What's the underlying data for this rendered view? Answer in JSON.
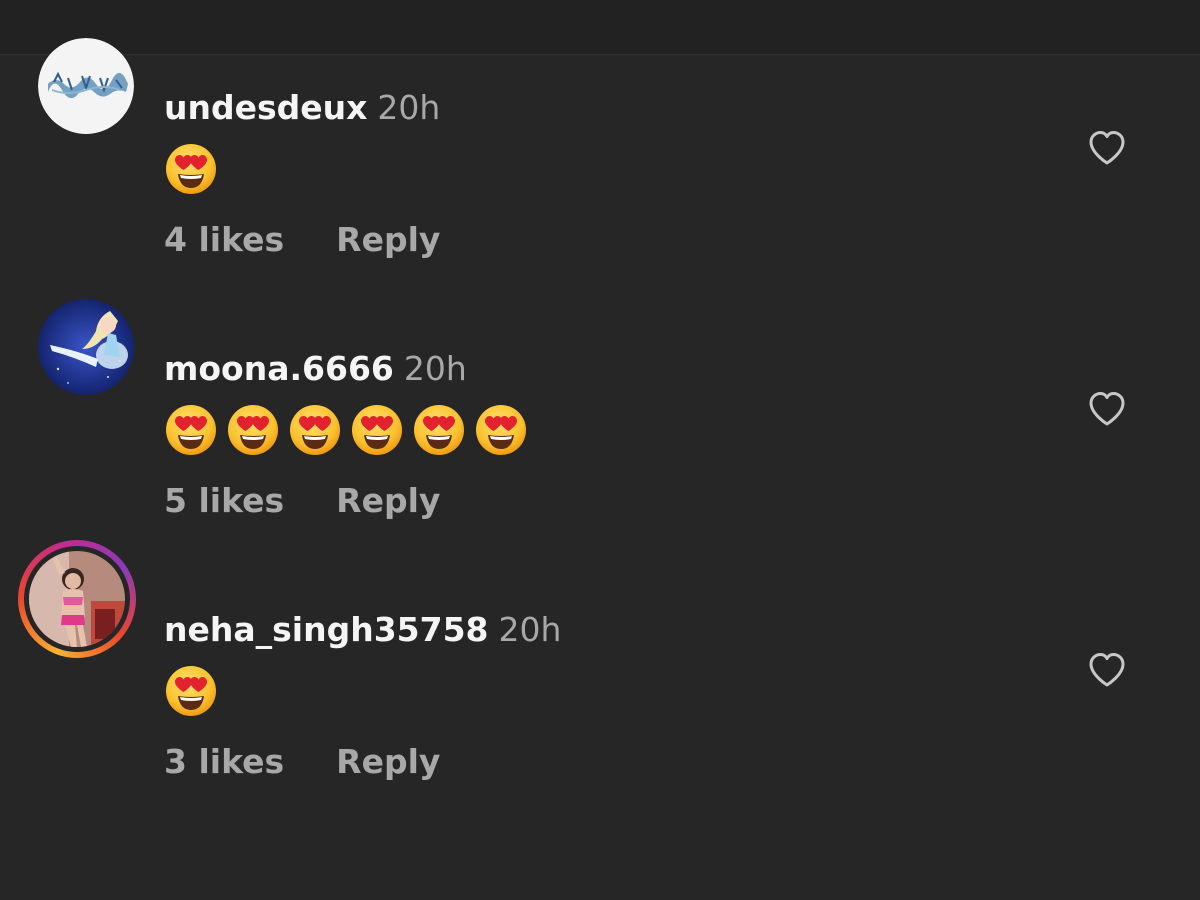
{
  "comments": [
    {
      "username": "undesdeux",
      "time": "20h",
      "emoji": "heart-eyes-emoji",
      "emoji_count": 1,
      "likes": "4 likes",
      "reply": "Reply"
    },
    {
      "username": "moona.6666",
      "time": "20h",
      "emoji": "heart-eyes-emoji",
      "emoji_count": 6,
      "likes": "5 likes",
      "reply": "Reply"
    },
    {
      "username": "neha_singh35758",
      "time": "20h",
      "emoji": "heart-eyes-emoji",
      "emoji_count": 1,
      "likes": "3 likes",
      "reply": "Reply",
      "has_story_ring": true
    }
  ],
  "colors": {
    "background": "#262626",
    "username": "#f5f5f5",
    "secondary_text": "#a8a8a8",
    "heart_outline": "#c7c7c7"
  },
  "icons": {
    "like": "heart-outline-icon"
  }
}
